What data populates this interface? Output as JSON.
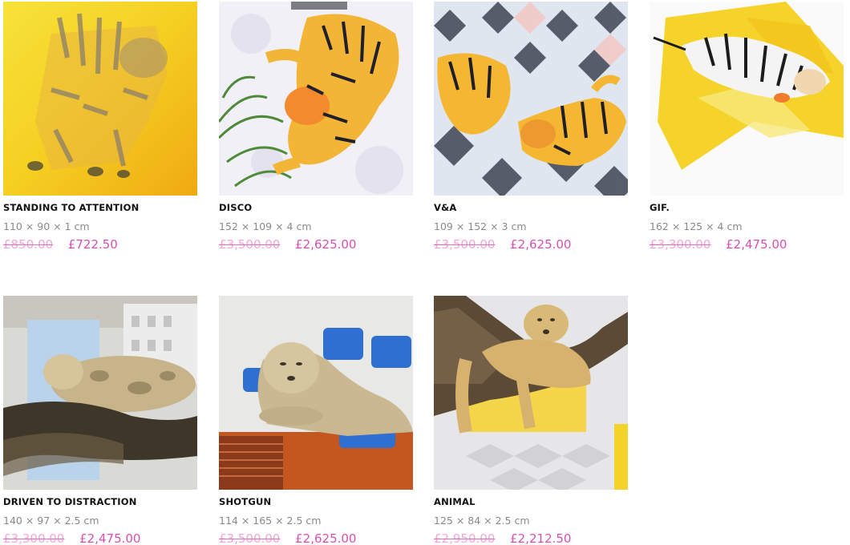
{
  "colors": {
    "old_price": "#f3a6d6",
    "new_price": "#d94fb0",
    "title": "#111111",
    "dims": "#8a8a8a"
  },
  "artworks": [
    {
      "title": "STANDING TO ATTENTION",
      "dimensions": "110 × 90 × 1 cm",
      "original_price": "£850.00",
      "sale_price": "£722.50",
      "image": "yellow-tiger-painting"
    },
    {
      "title": "DISCO",
      "dimensions": "152 × 109 × 4 cm",
      "original_price": "£3,500.00",
      "sale_price": "£2,625.00",
      "image": "leaping-tiger-painting"
    },
    {
      "title": "V&A",
      "dimensions": "109 × 152 × 3 cm",
      "original_price": "£3,500.00",
      "sale_price": "£2,625.00",
      "image": "two-tigers-tiled-floor-painting"
    },
    {
      "title": "GIF.",
      "dimensions": "162 × 125 × 4 cm",
      "original_price": "£3,300.00",
      "sale_price": "£2,475.00",
      "image": "lying-tiger-yellow-painting"
    },
    {
      "title": "DRIVEN TO DISTRACTION",
      "dimensions": "140 × 97 × 2.5 cm",
      "original_price": "£3,300.00",
      "sale_price": "£2,475.00",
      "image": "lioness-on-branch-painting"
    },
    {
      "title": "SHOTGUN",
      "dimensions": "114 × 165 × 2.5 cm",
      "original_price": "£3,500.00",
      "sale_price": "£2,625.00",
      "image": "lioness-train-seat-painting"
    },
    {
      "title": "ANIMAL",
      "dimensions": "125 × 84 × 2.5 cm",
      "original_price": "£2,950.00",
      "sale_price": "£2,212.50",
      "image": "lioness-tree-painting"
    }
  ]
}
